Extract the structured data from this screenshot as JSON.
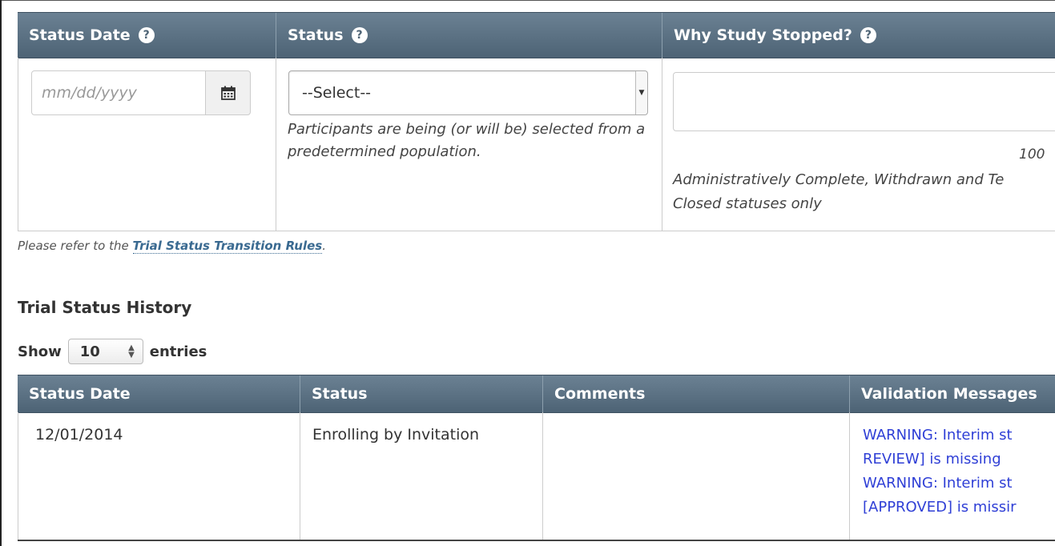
{
  "form": {
    "headers": {
      "status_date": "Status Date",
      "status": "Status",
      "why_stopped": "Why Study Stopped?"
    },
    "help_icon": "question-circle-icon",
    "date_placeholder": "mm/dd/yyyy",
    "calendar_icon": "calendar-icon",
    "status_select_value": "--Select--",
    "status_help": "Participants are being (or will be) selected from a predetermined population.",
    "why_char_count": "100",
    "why_help_line1": "Administratively Complete, Withdrawn and Te",
    "why_help_line2": "Closed statuses only"
  },
  "refer_note": {
    "prefix": "Please refer to the ",
    "link": "Trial Status Transition Rules",
    "suffix": "."
  },
  "history": {
    "title": "Trial Status History",
    "show_label": "Show",
    "show_value": "10",
    "entries_label": "entries",
    "columns": [
      "Status Date",
      "Status",
      "Comments",
      "Validation Messages"
    ],
    "rows": [
      {
        "status_date": "12/01/2014",
        "status": "Enrolling by Invitation",
        "comments": "",
        "messages": [
          "WARNING: Interim st",
          "REVIEW] is missing",
          "WARNING: Interim st",
          "[APPROVED] is missir"
        ]
      }
    ]
  },
  "colors": {
    "header_bg": "#5a6f80",
    "link": "#3a6a91",
    "warning_text": "#2f3fd6"
  }
}
